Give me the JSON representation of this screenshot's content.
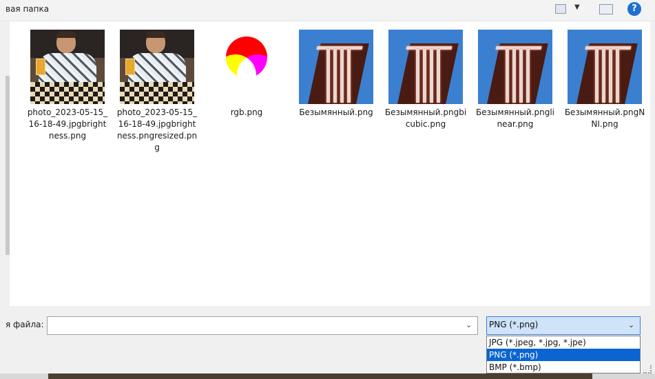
{
  "toolbar": {
    "breadcrumb": "вая папка",
    "help_label": "?"
  },
  "files": [
    {
      "name": "photo_2023-05-15_16-18-49.jpgbrightness.png",
      "thumb": "photo"
    },
    {
      "name": "photo_2023-05-15_16-18-49.jpgbrightness.pngresized.png",
      "thumb": "photo"
    },
    {
      "name": "rgb.png",
      "thumb": "rgb"
    },
    {
      "name": "Безымянный.png",
      "thumb": "neon"
    },
    {
      "name": "Безымянный.pngbicubic.png",
      "thumb": "neon"
    },
    {
      "name": "Безымянный.pnglinear.png",
      "thumb": "neon"
    },
    {
      "name": "Безымянный.pngNNI.png",
      "thumb": "neon"
    }
  ],
  "save_form": {
    "filename_label": "я файла:",
    "filename_value": "",
    "filter_selected": "PNG (*.png)",
    "filter_options": [
      "JPG (*.jpeg, *.jpg, *.jpe)",
      "PNG (*.png)",
      "BMP (*.bmp)"
    ]
  },
  "icons": {
    "dropdown_arrow": "chevron-down-icon"
  },
  "colors": {
    "selection": "#0a64d2",
    "filter_highlight": "#cfe3fb",
    "help": "#1e6fd0"
  }
}
